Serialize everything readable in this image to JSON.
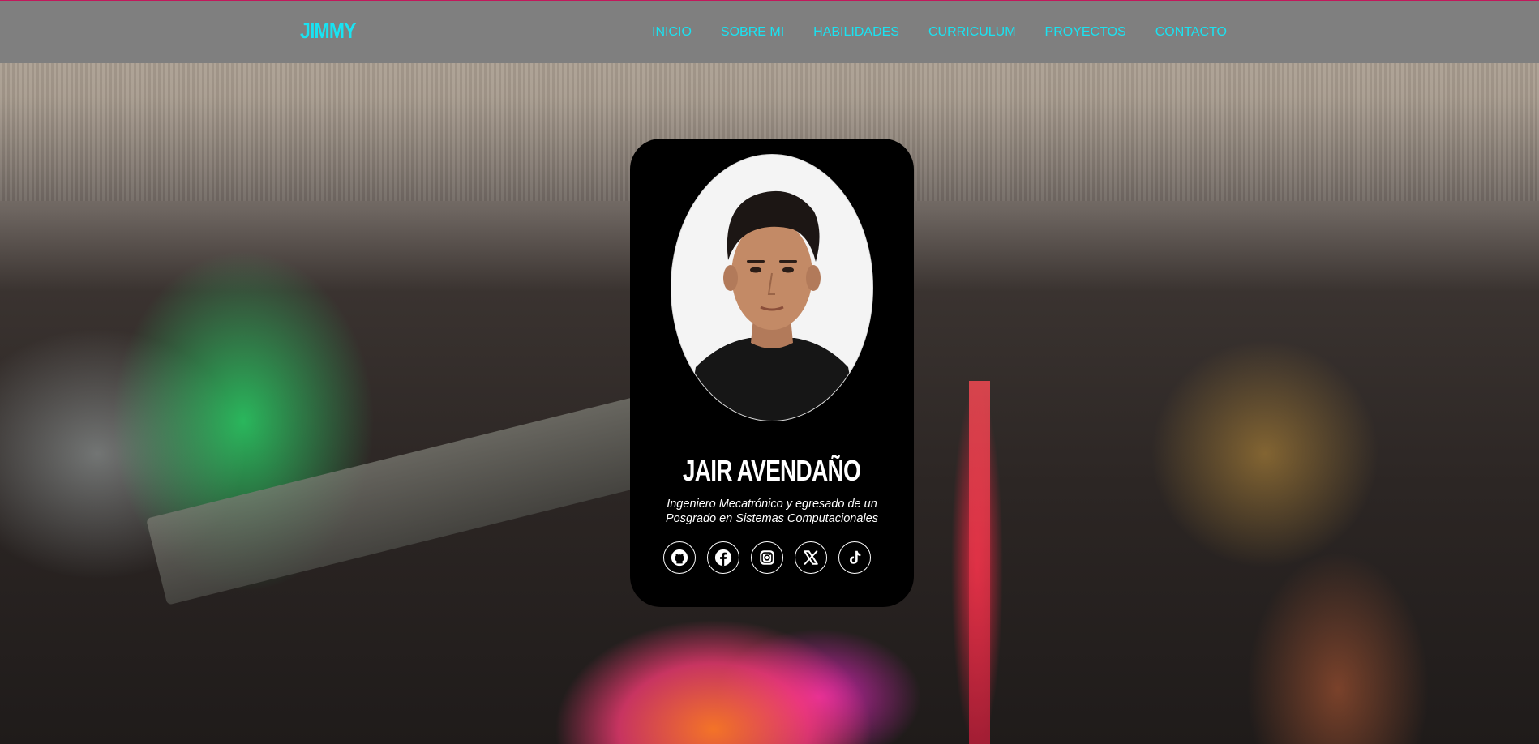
{
  "navbar": {
    "brand": "JIMMY",
    "links": [
      {
        "label": "INICIO"
      },
      {
        "label": "SOBRE MI"
      },
      {
        "label": "HABILIDADES"
      },
      {
        "label": "CURRICULUM"
      },
      {
        "label": "PROYECTOS"
      },
      {
        "label": "CONTACTO"
      }
    ]
  },
  "profile": {
    "name": "JAIR AVENDAÑO",
    "bio": "Ingeniero Mecatrónico y egresado de un Posgrado en Sistemas Computacionales",
    "photo_icon": "profile-photo",
    "socials": [
      {
        "icon": "github-icon"
      },
      {
        "icon": "facebook-icon"
      },
      {
        "icon": "instagram-icon"
      },
      {
        "icon": "x-icon"
      },
      {
        "icon": "tiktok-icon"
      }
    ]
  },
  "colors": {
    "accent": "#19e3f2",
    "navbar_bg": "#7f7f7f",
    "card_bg": "#000000"
  }
}
